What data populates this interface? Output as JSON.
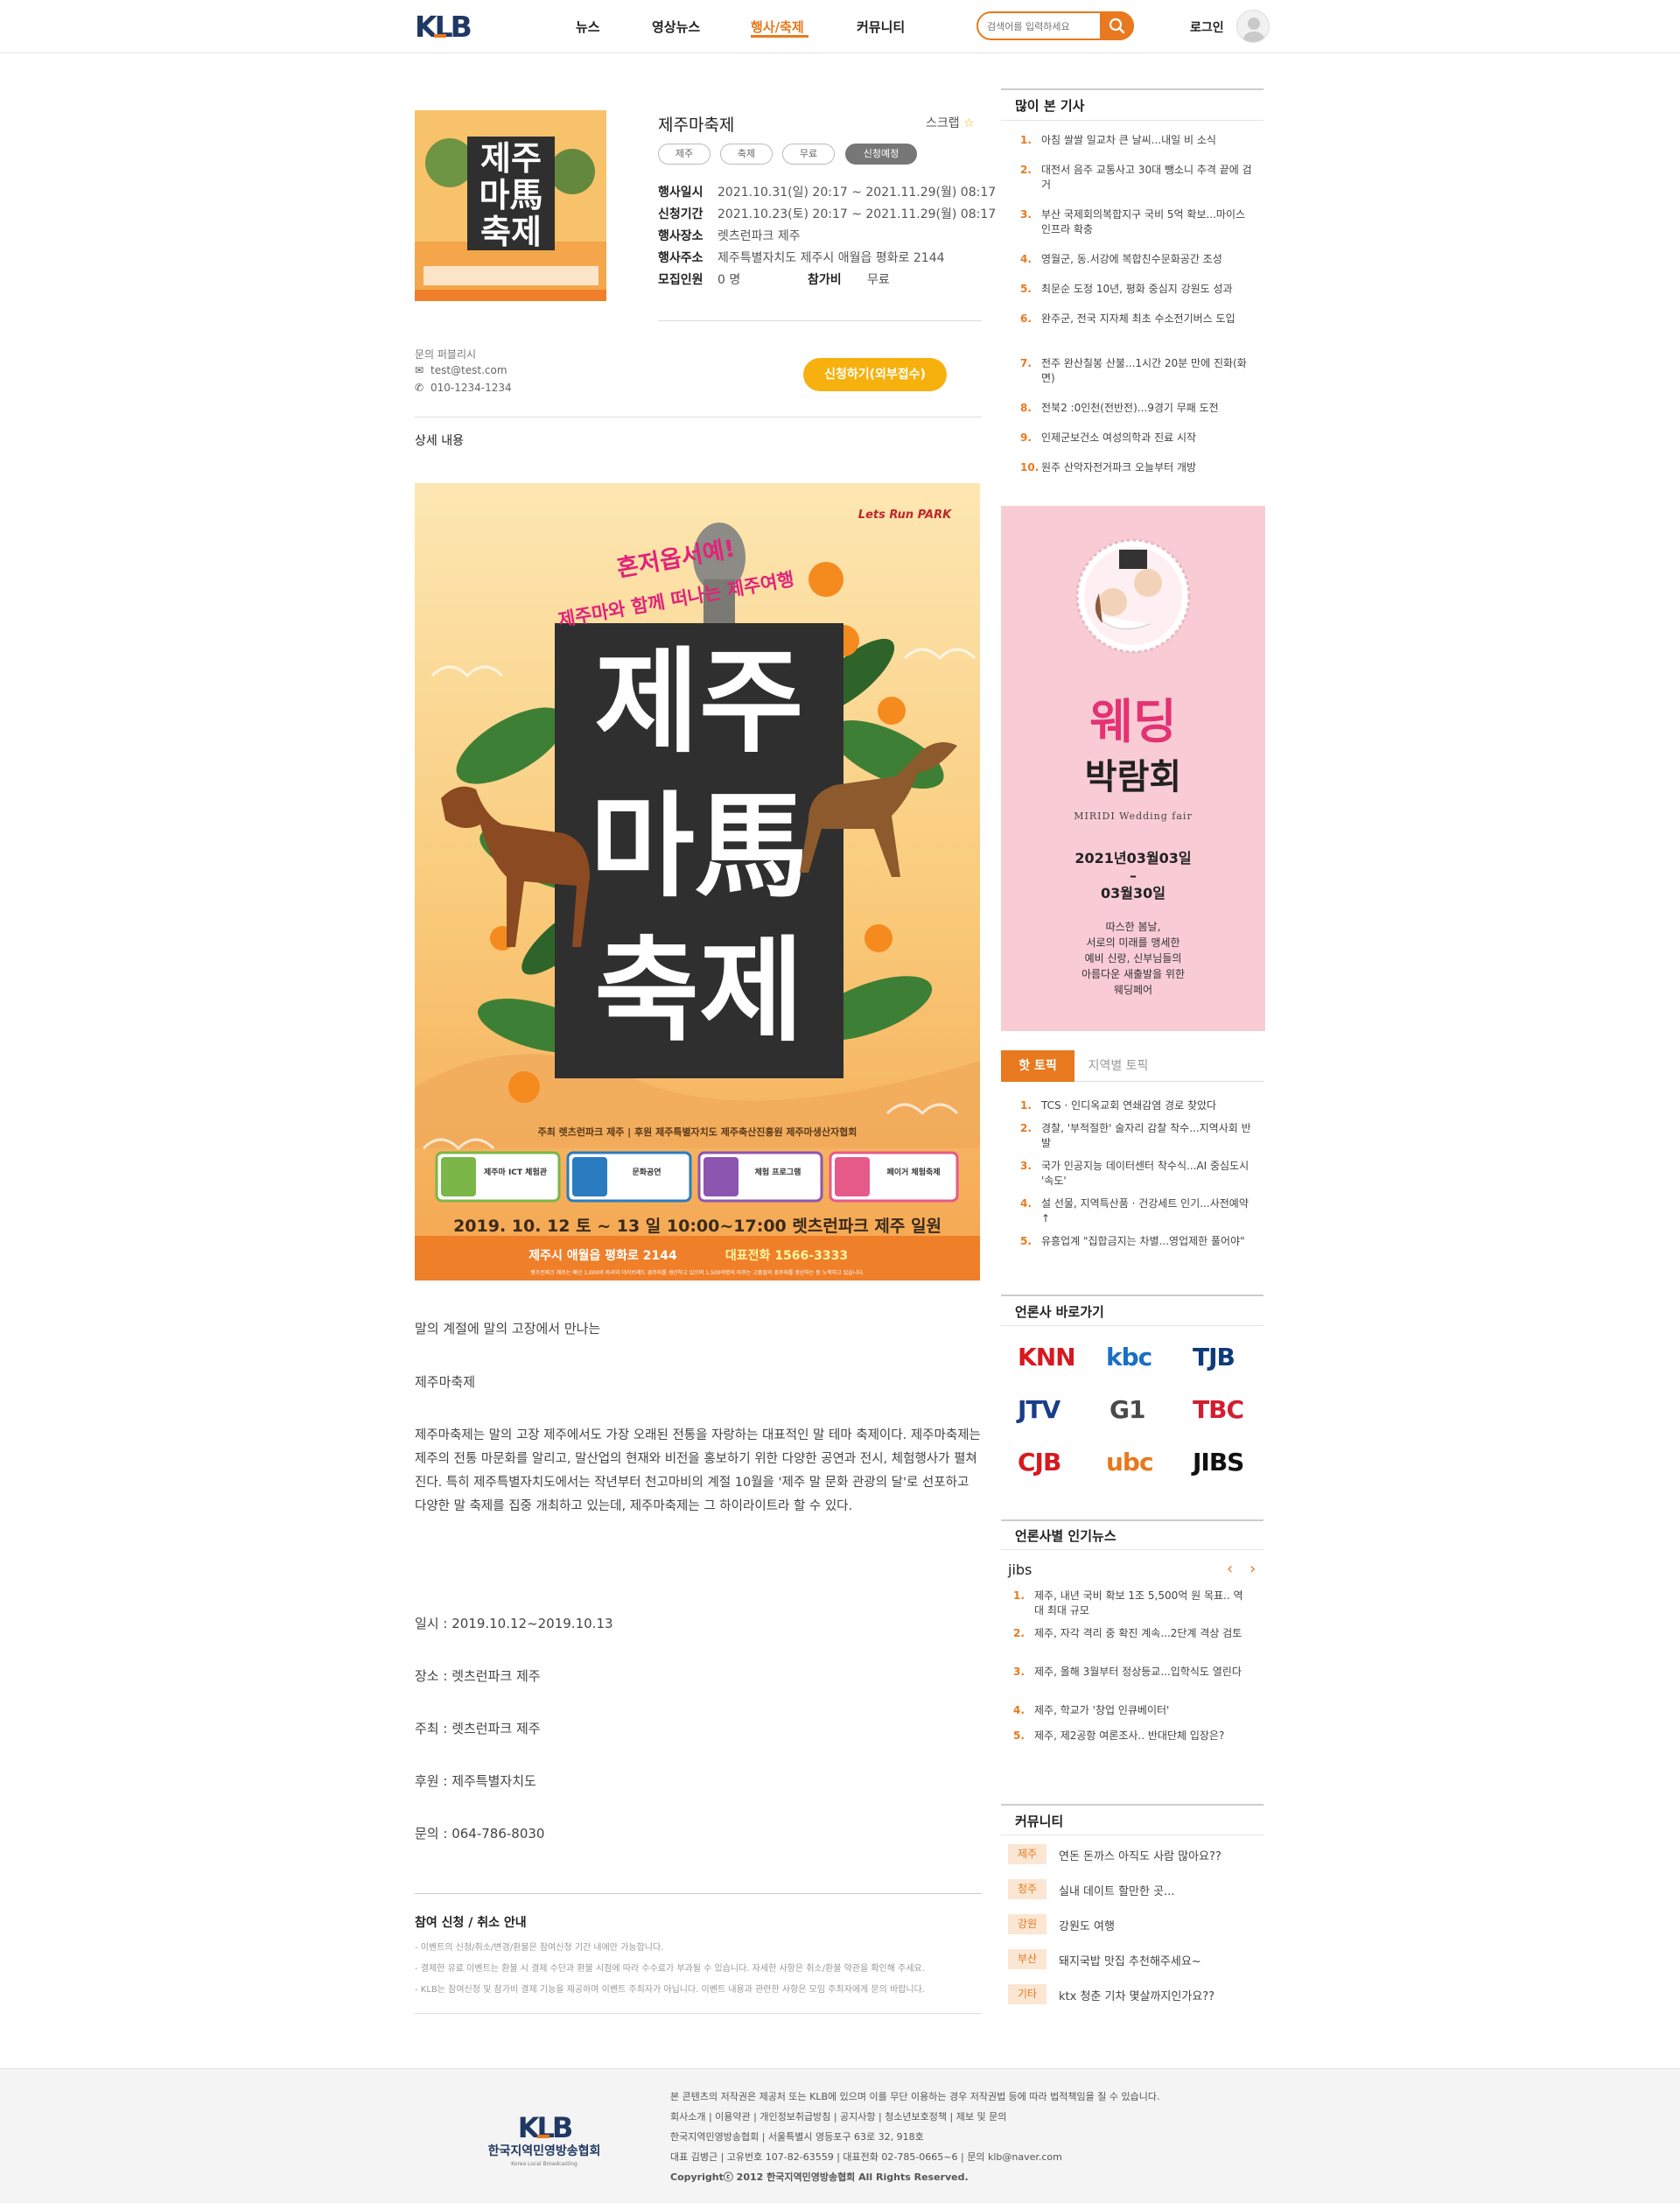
{
  "header": {
    "nav": [
      "뉴스",
      "영상뉴스",
      "행사/축제",
      "커뮤니티"
    ],
    "active_nav": "행사/축제",
    "search_placeholder": "검색어를 입력하세요",
    "login": "로그인",
    "accent": "#e8791e"
  },
  "event": {
    "title": "제주마축제",
    "scrap": "스크랩",
    "tags": [
      "제주",
      "축제",
      "무료",
      "신청예정"
    ],
    "info": [
      {
        "label": "행사일시",
        "value": "2021.10.31(일) 20:17 ~ 2021.11.29(월) 08:17"
      },
      {
        "label": "신청기간",
        "value": "2021.10.23(토) 20:17 ~ 2021.11.29(월) 08:17"
      },
      {
        "label": "행사장소",
        "value": "렛츠런파크 제주"
      },
      {
        "label": "행사주소",
        "value": "제주특별자치도 제주시 애월읍 평화로 2144"
      },
      {
        "label": "모집인원",
        "value": "0 명"
      },
      {
        "label": "참가비",
        "value": "무료"
      }
    ],
    "contact_head": "문의  퍼블리시",
    "email": "test@test.com",
    "phone": "010-1234-1234",
    "apply_button": "신청하기(외부접수)",
    "detail_head": "상세 내용"
  },
  "poster": {
    "slogan1": "혼저옵서예!",
    "slogan2": "제주마와 함께 떠나는 제주여행",
    "title_lines": [
      "제주",
      "마馬",
      "축제"
    ],
    "park_logo": "Lets Run PARK",
    "sponsors": "주최  렛츠런파크 제주  |  후원  제주특별자치도  제주축산진흥원  제주마생산자협회",
    "programs": [
      "제주마 ICT 체험관",
      "문화공연",
      "체험 프로그램",
      "페이거 체험축제"
    ],
    "date": "2019. 10. 12 토 ~ 13 일  10:00~17:00  렛츠런파크 제주 일원",
    "address": "제주시 애월읍 평화로 2144",
    "phone": "대표전화  1566-3333",
    "fine_print": "렛츠런파크 제주는 매년 1,000여 마리의 더러브레드 경주마를 생산하고 있으며 1,500여명의 마주는 고품질의 경주마를 생산하는 등 노력하고 있습니다."
  },
  "body": {
    "p1": "말의 계절에 말의 고장에서 만나는",
    "p2": "제주마축제",
    "p3": "제주마축제는 말의 고장 제주에서도 가장 오래된 전통을 자랑하는 대표적인 말 테마 축제이다.  제주마축제는 제주의 전통 마문화를 알리고, 말산업의 현재와 비전을 홍보하기 위한 다양한 공연과 전시, 체험행사가 펼쳐진다. 특히 제주특별자치도에서는 작년부터 천고마비의 계절 10월을 '제주 말 문화 관광의 달'로 선포하고 다양한 말 축제를 집중 개최하고 있는데, 제주마축제는 그 하이라이트라 할 수 있다.",
    "date": "일시 : 2019.10.12~2019.10.13",
    "place": "장소 : 렛츠런파크 제주",
    "host": "주최 : 렛츠런파크 제주",
    "sponsor": "후원 : 제주특별자치도",
    "inquiry": "문의 : 064-786-8030"
  },
  "notice": {
    "head": "참여 신청 / 취소 안내",
    "lines": [
      "- 이벤트의 신청/취소/변경/환불은 참여신청 기간 내에만 가능합니다.",
      "- 결제한 유료 이벤트는 환불 시 결제 수단과 환불 시점에 따라 수수료가 부과될 수 있습니다. 자세한 사항은 취소/환불 약관을 확인해 주세요.",
      "- KLB는 참여신청 및 참가비 결제 기능을 제공하며 이벤트 주최자가 아닙니다. 이벤트 내용과 관련한 사항은 모임 주최자에게 문의 바랍니다."
    ]
  },
  "sidebar": {
    "popular_head": "많이 본 기사",
    "popular": [
      "아침 쌀쌀 일교차 큰 날씨...내일 비 소식",
      "대전서 음주 교통사고 30대 뺑소니 추격 끝에 검거",
      "부산 국제회의복합지구 국비 5억 확보...마이스 인프라 확충",
      "영월군, 동.서강에 복합친수문화공간 조성",
      "최문순 도정 10년, 평화 중심지 강원도 성과",
      "완주군, 전국 지자체 최초 수소전기버스 도입",
      "전주 완산칠봉 산불...1시간 20분 만에 진화(화면)",
      "전북2 :0인천(전반전)...9경기 무패 도전",
      "인제군보건소 여성의학과 진료 시작",
      "원주 산악자전거파크 오늘부터 개방"
    ],
    "ad": {
      "title1": "웨딩",
      "title2": "박람회",
      "subtitle": "MIRIDI Wedding fair",
      "date1": "2021년03월03일",
      "dash": "–",
      "date2": "03월30일",
      "desc": [
        "따스한 봄날,",
        "서로의 미래를 맹세한",
        "예비 신랑, 신부님들의",
        "아름다운 새출발을 위한",
        "웨딩페어"
      ]
    },
    "hot_tabs": [
      "핫 토픽",
      "지역별 토픽"
    ],
    "hot": [
      "TCS · 인디옥교회 연쇄감염 경로 찾았다",
      "경찰, '부적절한' 술자리 감찰 착수...지역사회 반발",
      "국가 인공지능 데이터센터 착수식...AI 중심도시 '속도'",
      "설 선물, 지역특산품 · 건강세트 인기...사전예약↑",
      "유흥업계 \"집합금지는 차별...영업제한 풀어야\""
    ],
    "media_head": "언론사 바로가기",
    "media": [
      "KNN",
      "kbc",
      "TJB",
      "JTV",
      "G1",
      "TBC",
      "CJB",
      "ubc",
      "JIBS"
    ],
    "media_pop_head": "언론사별 인기뉴스",
    "media_pop_source": "jibs",
    "media_pop": [
      "제주, 내년 국비 확보 1조 5,500억 원 목표.. 역대 최대 규모",
      "제주, 자각 격리 중 확진 계속...2단계 격상 검토",
      "제주, 올해 3월부터 정상등교...입학식도 열린다",
      "제주, 학교가 '창업 인큐베이터'",
      "제주, 제2공항 여론조사.. 반대단체 입장은?"
    ],
    "community_head": "커뮤니티",
    "community": [
      {
        "tag": "제주",
        "text": "연돈 돈까스 아직도 사람 많아요??"
      },
      {
        "tag": "청주",
        "text": "실내 데이트 할만한 곳..."
      },
      {
        "tag": "강원",
        "text": "강원도 여행"
      },
      {
        "tag": "부산",
        "text": "돼지국밥 맛집 추천해주세요~"
      },
      {
        "tag": "기타",
        "text": "ktx 청춘 기차 몇살까지인가요??"
      }
    ]
  },
  "footer": {
    "org_name": "한국지역민영방송협회",
    "org_sub": "Korea Local Broadcasting",
    "notice": "본 콘텐츠의 저작권은 제공처 또는 KLB에 있으며 이를 무단 이용하는 경우 저작권법 등에 따라 법적책임을 질 수 있습니다.",
    "links": "회사소개  |  이용약관  |  개인정보취급방침  |  공지사항  |  청소년보호정책  |  제보 및 문의",
    "address": "한국지역민영방송협회  |  서울특별시 영등포구 63로 32, 918호",
    "ceo": "대표 김병근  |  고유번호 107-82-63559  |  대표전화 02-785-0665~6  |  문의 klb@naver.com",
    "copyright": "Copyrightⓒ 2012 한국지역민영방송협회 All Rights Reserved."
  }
}
